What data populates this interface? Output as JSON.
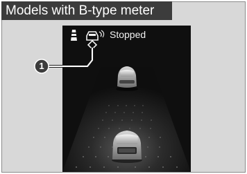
{
  "heading": "Models with B-type meter",
  "display": {
    "status_text": "Stopped",
    "icons": [
      "lane-indicator-icon",
      "stopped-vehicle-icon"
    ]
  },
  "callout": {
    "number": "1"
  }
}
